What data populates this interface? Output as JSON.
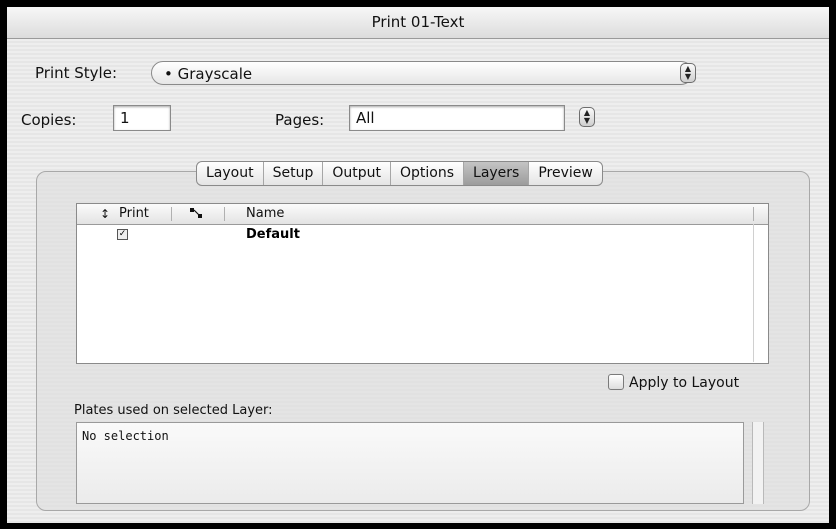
{
  "window": {
    "title": "Print 01-Text"
  },
  "print_style": {
    "label": "Print Style:",
    "value": "• Grayscale"
  },
  "copies": {
    "label": "Copies:",
    "value": "1"
  },
  "pages": {
    "label": "Pages:",
    "value": "All"
  },
  "tabs": [
    {
      "label": "Layout",
      "selected": false
    },
    {
      "label": "Setup",
      "selected": false
    },
    {
      "label": "Output",
      "selected": false
    },
    {
      "label": "Options",
      "selected": false
    },
    {
      "label": "Layers",
      "selected": true
    },
    {
      "label": "Preview",
      "selected": false
    }
  ],
  "layers_table": {
    "columns": {
      "sort": "↕",
      "print": "Print",
      "name": "Name"
    },
    "rows": [
      {
        "print": true,
        "name": "Default"
      }
    ]
  },
  "apply_to_layout": {
    "label": "Apply to Layout",
    "checked": false
  },
  "plates": {
    "label": "Plates used on selected Layer:",
    "text": "No selection"
  }
}
